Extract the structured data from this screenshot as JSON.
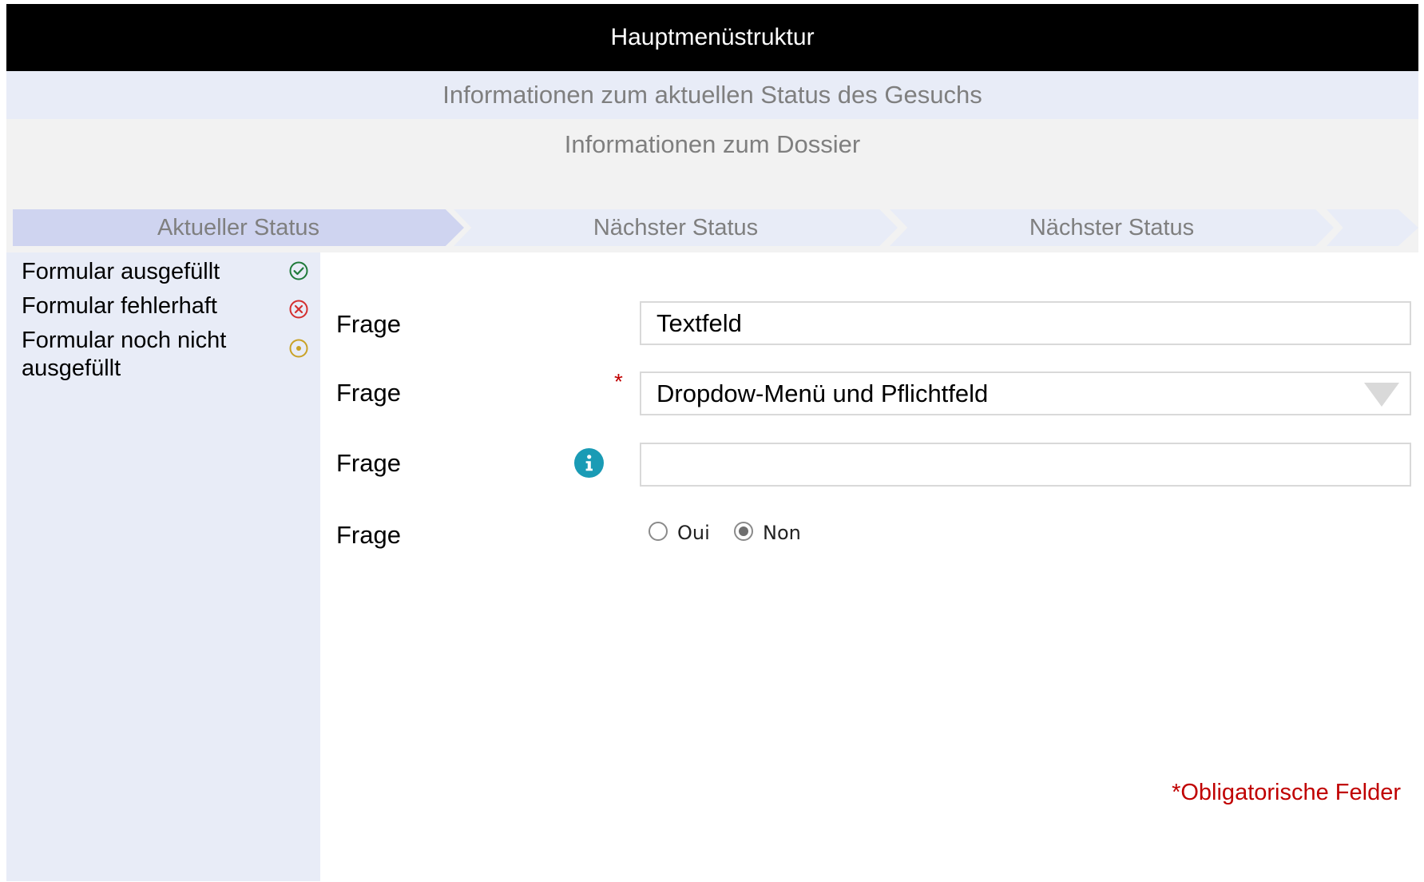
{
  "header": {
    "menu_title": "Hauptmenüstruktur",
    "status_info": "Informationen zum aktuellen Status des Gesuchs",
    "dossier_info": "Informationen zum Dossier"
  },
  "progress_steps": [
    {
      "label": "Aktueller Status",
      "state": "current"
    },
    {
      "label": "Nächster Status",
      "state": "upcoming"
    },
    {
      "label": "Nächster Status",
      "state": "upcoming"
    },
    {
      "label": "",
      "state": "upcoming"
    }
  ],
  "legend": {
    "items": [
      {
        "label": "Formular ausgefüllt",
        "icon": "check-circle-icon",
        "color": "#1f7a3a"
      },
      {
        "label": "Formular fehlerhaft",
        "icon": "x-circle-icon",
        "color": "#d32f2f"
      },
      {
        "label": "Formular noch nicht ausgefüllt",
        "icon": "dot-circle-icon",
        "color": "#c9a227"
      }
    ]
  },
  "form": {
    "rows": [
      {
        "question": "Frage",
        "type": "text",
        "value": "Textfeld"
      },
      {
        "question": "Frage",
        "type": "dropdown",
        "value": "Dropdow-Menü und Pflichtfeld",
        "required": true,
        "required_marker": "*"
      },
      {
        "question": "Frage",
        "type": "text",
        "value": "",
        "info_icon": "info-icon",
        "info_color": "#1a9bb5"
      },
      {
        "question": "Frage",
        "type": "radio",
        "options": [
          {
            "label": "Oui",
            "checked": false
          },
          {
            "label": "Non",
            "checked": true
          }
        ]
      }
    ],
    "obligatory_note": "*Obligatorische Felder"
  },
  "colors": {
    "menu_bg": "#000000",
    "status_bg": "#e8ecf7",
    "dossier_bg": "#f2f2f2",
    "current_step_bg": "#cfd4f0",
    "required_red": "#c00000"
  }
}
